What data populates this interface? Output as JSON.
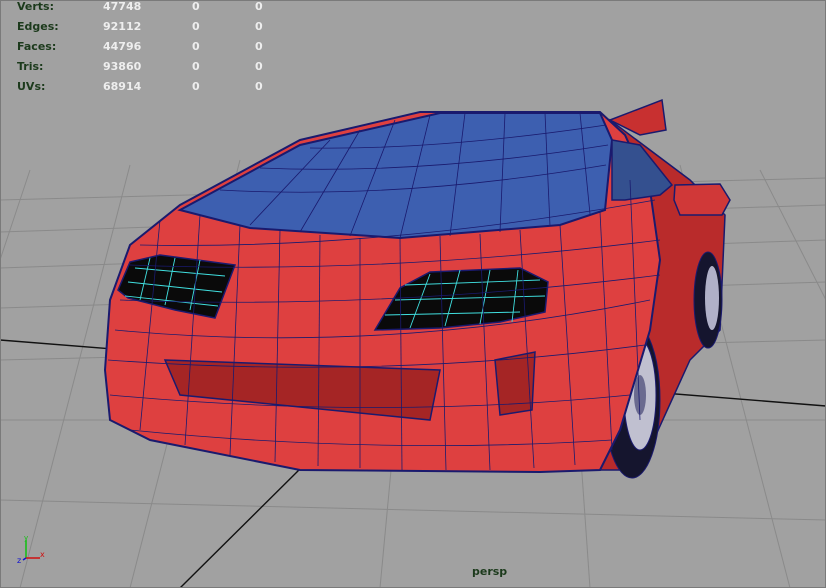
{
  "viewport": {
    "camera_label": "persp",
    "background_color": "#a1a1a1",
    "grid_color": "#888888",
    "axis_line_color": "#111111"
  },
  "hud": {
    "rows": [
      {
        "label": "Verts:",
        "v1": "47748",
        "v2": "0",
        "v3": "0"
      },
      {
        "label": "Edges:",
        "v1": "92112",
        "v2": "0",
        "v3": "0"
      },
      {
        "label": "Faces:",
        "v1": "44796",
        "v2": "0",
        "v3": "0"
      },
      {
        "label": "Tris:",
        "v1": "93860",
        "v2": "0",
        "v3": "0"
      },
      {
        "label": "UVs:",
        "v1": "68914",
        "v2": "0",
        "v3": "0"
      }
    ]
  },
  "axis_gizmo": {
    "x_label": "x",
    "y_label": "y",
    "z_label": "z",
    "x_color": "#d01010",
    "y_color": "#10c010",
    "z_color": "#1010d0"
  },
  "model": {
    "body_color": "#d83a3a",
    "glass_color": "#3d5fb0",
    "wire_color": "#1a1a6e",
    "window_wire_color": "#40e0e0",
    "tire_color": "#1a1a30"
  }
}
